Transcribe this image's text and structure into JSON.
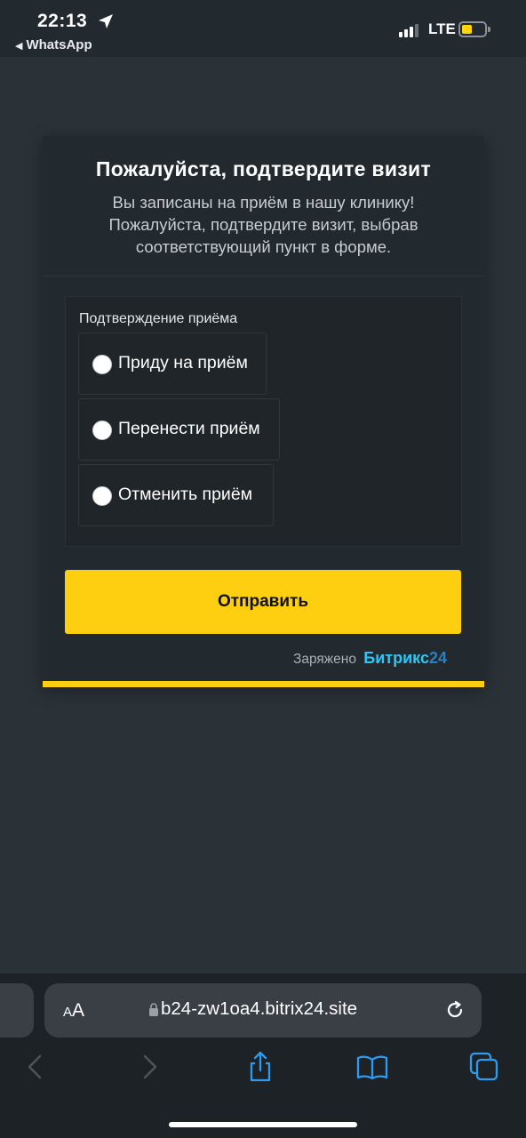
{
  "status_bar": {
    "time": "22:13",
    "back_app": "WhatsApp",
    "network": "LTE"
  },
  "form": {
    "title": "Пожалуйста, подтвердите визит",
    "subtitle": "Вы записаны на приём в нашу клинику! Пожалуйста, подтвердите визит, выбрав соответствующий пункт в форме.",
    "field_label": "Подтверждение приёма",
    "options": [
      "Приду на приём",
      "Перенести приём",
      "Отменить приём"
    ],
    "submit_label": "Отправить",
    "powered_by": "Заряжено",
    "brand_name": "Битрикс",
    "brand_number": "24"
  },
  "browser": {
    "text_size_small": "A",
    "text_size_large": "A",
    "url": "b24-zw1oa4.bitrix24.site"
  },
  "colors": {
    "accent": "#fece11",
    "brand": "#2fc6f6",
    "card_bg": "#222a2f",
    "page_bg": "#2a3238",
    "toolbar_icon": "#2e9bf0"
  },
  "icons": [
    "location-arrow-icon",
    "signal-icon",
    "battery-icon",
    "lock-icon",
    "reload-icon",
    "back-icon",
    "forward-icon",
    "share-icon",
    "bookmarks-icon",
    "tabs-icon"
  ]
}
